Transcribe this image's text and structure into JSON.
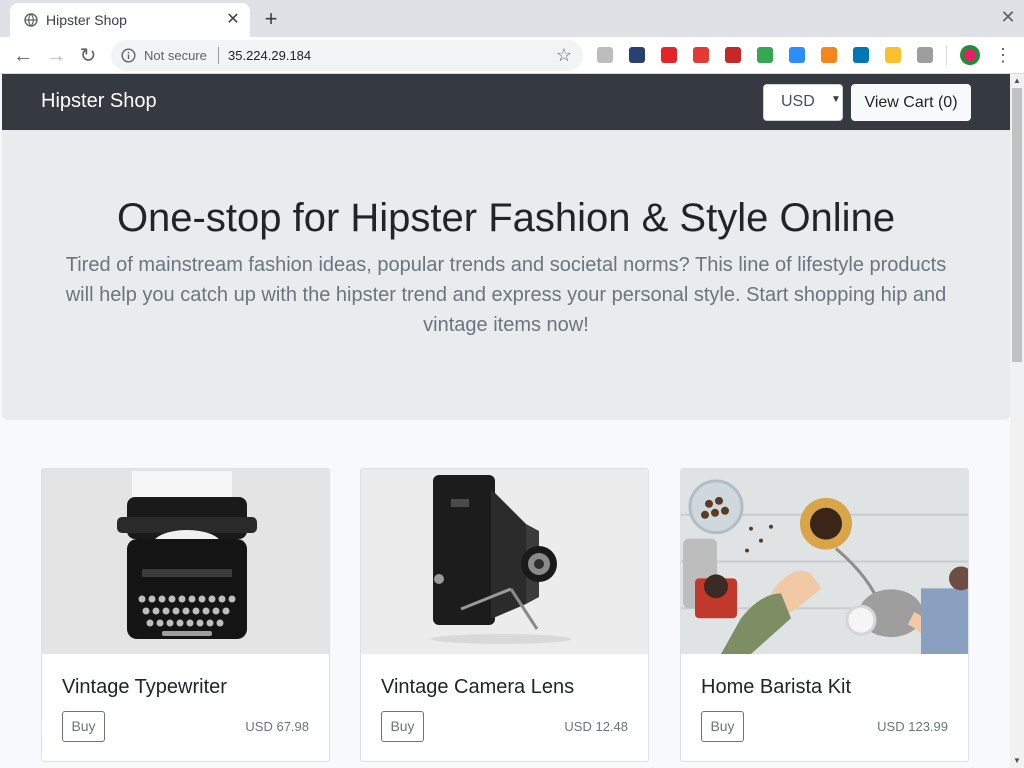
{
  "browser": {
    "tab_title": "Hipster Shop",
    "tab_close": "✕",
    "new_tab": "+",
    "window_close": "✕",
    "back": "←",
    "forward": "→",
    "reload": "↻",
    "security_label": "Not secure",
    "url": "35.224.29.184",
    "bookmark": "☆",
    "menu": "⋮",
    "extensions": [
      {
        "name": "b-extension-icon",
        "color": "#bdbdbd"
      },
      {
        "name": "fedora-icon",
        "color": "#294172"
      },
      {
        "name": "acrobat-icon",
        "color": "#e3242b"
      },
      {
        "name": "fetch-icon",
        "color": "#e53935"
      },
      {
        "name": "book-icon",
        "color": "#c62828"
      },
      {
        "name": "google-drive-icon",
        "color": "#34a853"
      },
      {
        "name": "zoom-icon",
        "color": "#2d8cff"
      },
      {
        "name": "metamask-icon",
        "color": "#f6851b"
      },
      {
        "name": "m-extension-icon",
        "color": "#0077b5"
      },
      {
        "name": "keychain-icon",
        "color": "#fbc02d"
      },
      {
        "name": "hubspot-icon",
        "color": "#9e9e9e"
      }
    ]
  },
  "header": {
    "brand": "Hipster Shop",
    "currency": "USD",
    "currency_caret": "▼",
    "view_cart": "View Cart (0)"
  },
  "hero": {
    "title": "One-stop for Hipster Fashion & Style Online",
    "lead": "Tired of mainstream fashion ideas, popular trends and societal norms? This line of lifestyle products will help you catch up with the hipster trend and express your personal style. Start shopping hip and vintage items now!"
  },
  "products": [
    {
      "name": "Vintage Typewriter",
      "buy": "Buy",
      "price": "USD 67.98"
    },
    {
      "name": "Vintage Camera Lens",
      "buy": "Buy",
      "price": "USD 12.48"
    },
    {
      "name": "Home Barista Kit",
      "buy": "Buy",
      "price": "USD 123.99"
    }
  ],
  "colors": {
    "navbar": "#343a40",
    "hero": "#e9ecef",
    "page": "#f8f9fa"
  }
}
